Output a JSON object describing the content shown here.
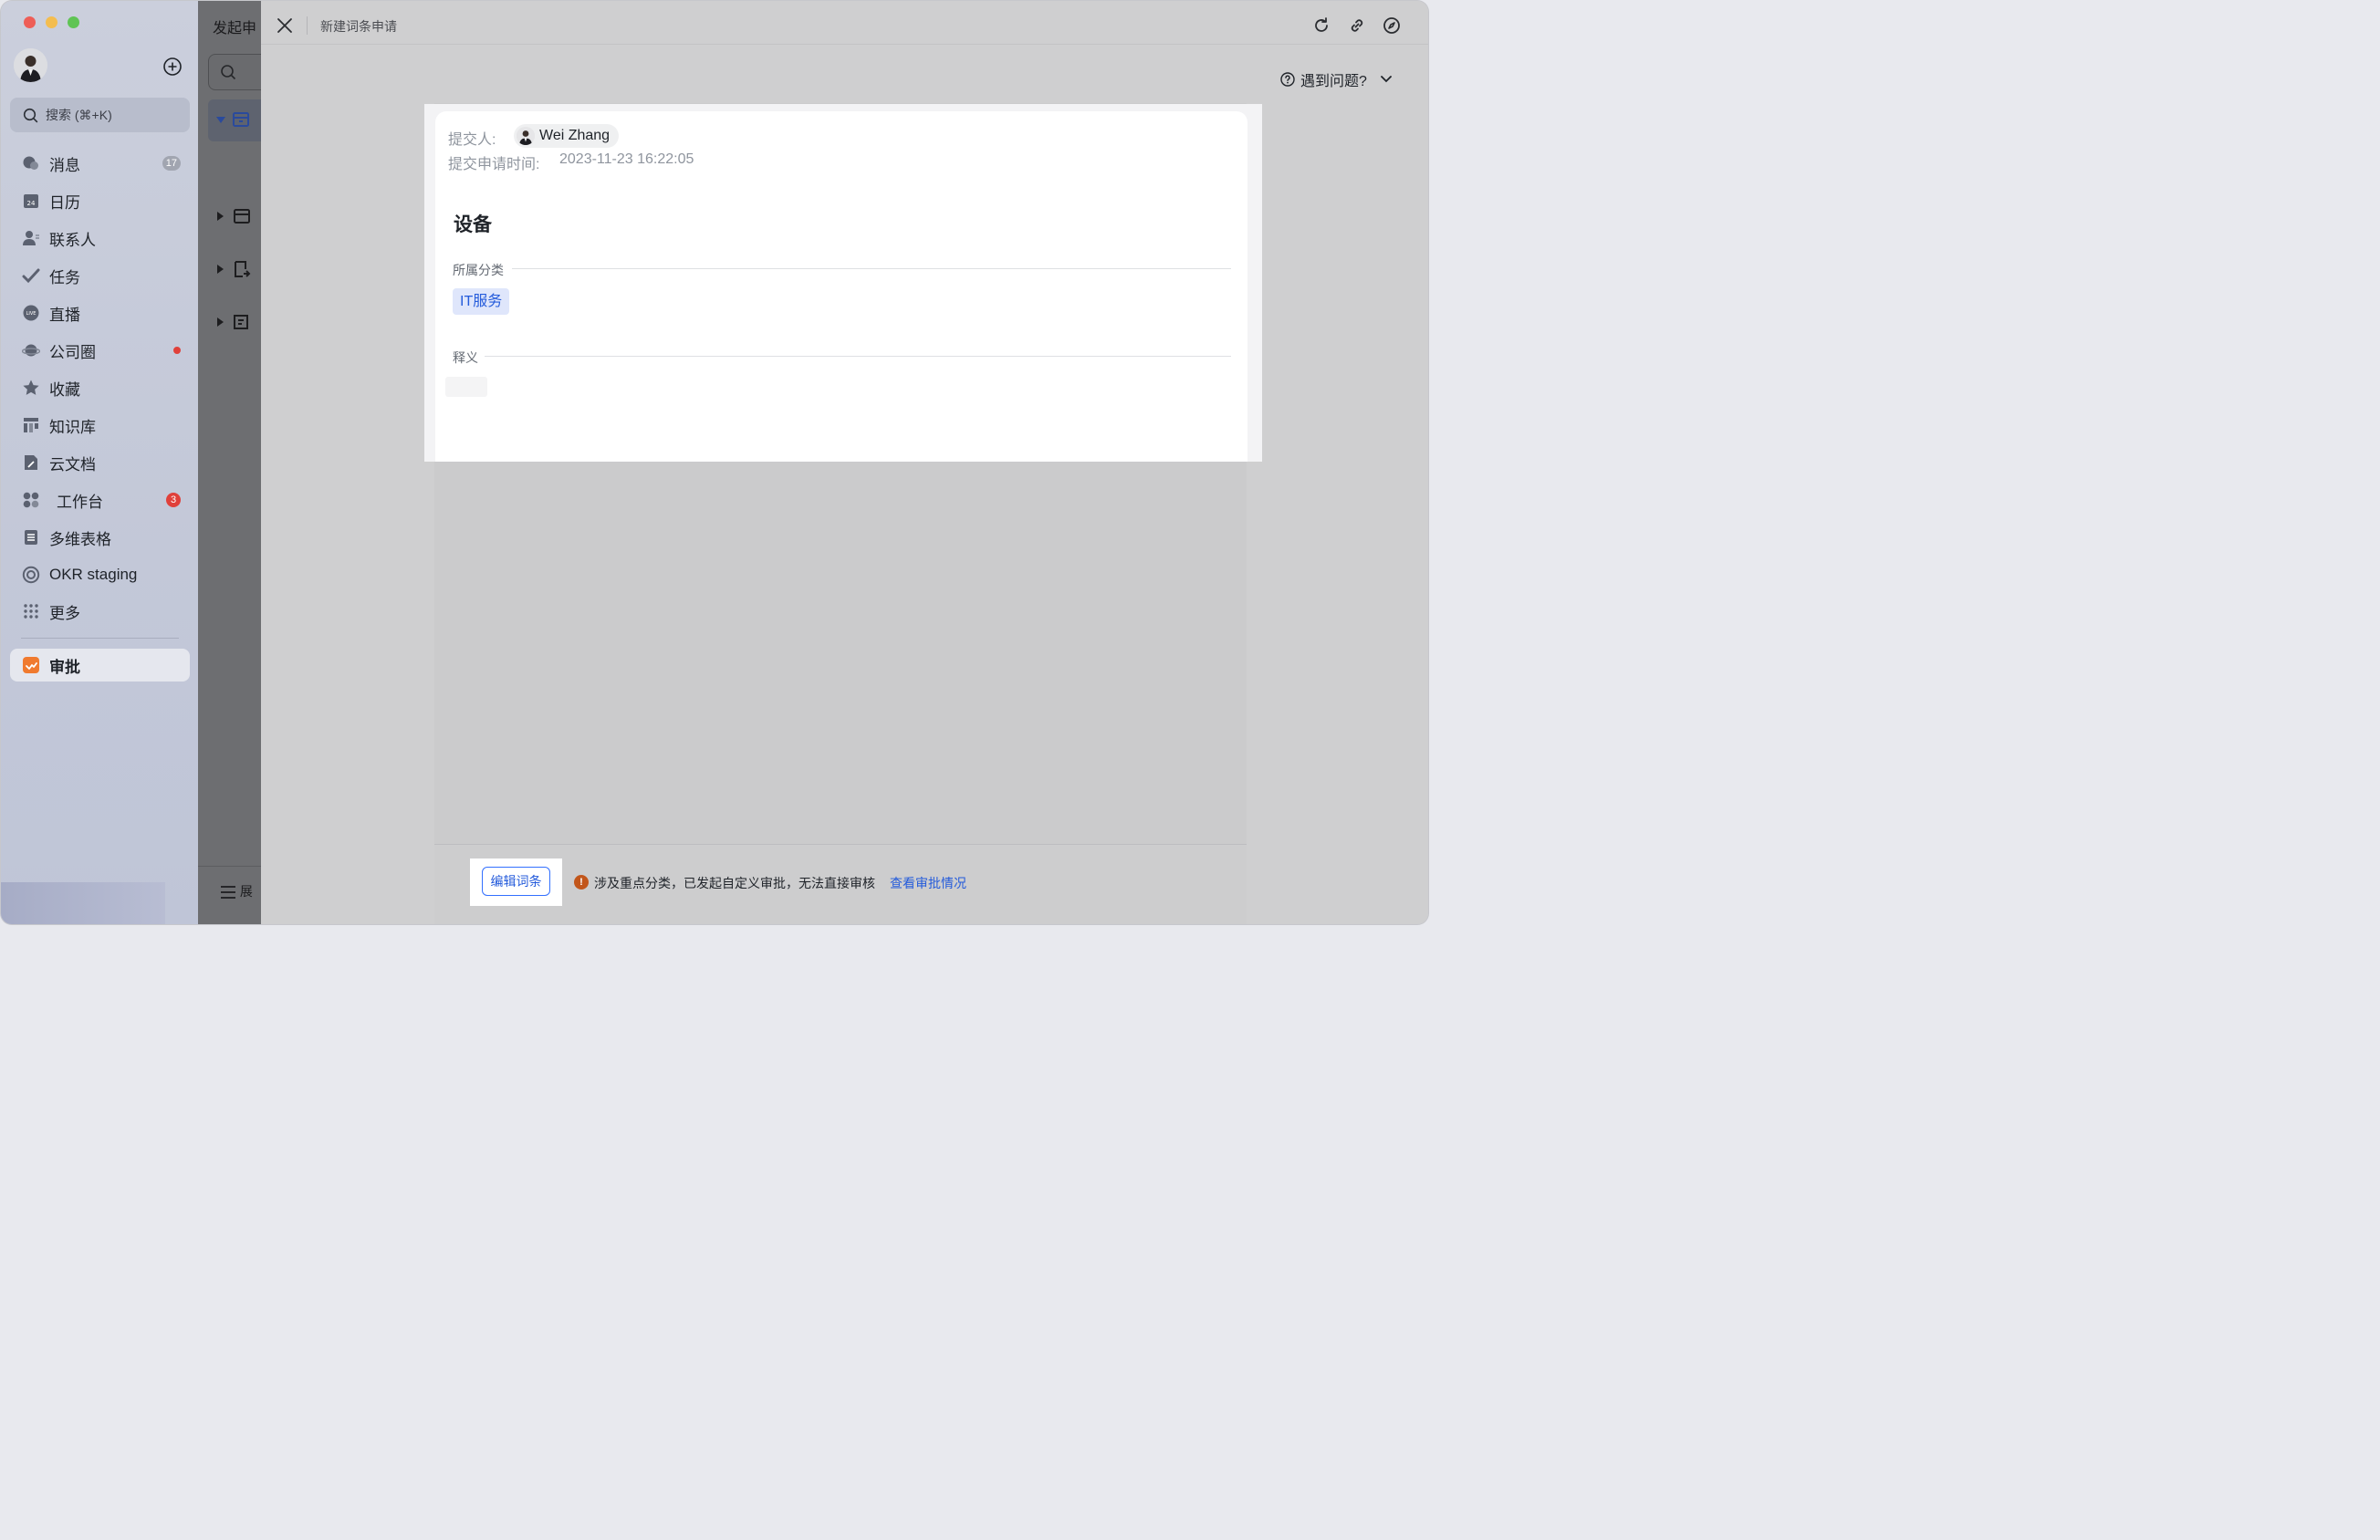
{
  "sidebar": {
    "search_placeholder": "搜索 (⌘+K)",
    "items": [
      {
        "label": "消息",
        "icon": "chat-bubble-icon",
        "badge": "17",
        "badge_color": "#a1a5b0"
      },
      {
        "label": "日历",
        "icon": "calendar-icon",
        "icon_text": "24"
      },
      {
        "label": "联系人",
        "icon": "contacts-icon"
      },
      {
        "label": "任务",
        "icon": "task-check-icon"
      },
      {
        "label": "直播",
        "icon": "live-icon",
        "icon_text": "LIVE"
      },
      {
        "label": "公司圈",
        "icon": "planet-icon",
        "has_dot": true,
        "dot_color": "#e0403a"
      },
      {
        "label": "收藏",
        "icon": "star-icon"
      },
      {
        "label": "知识库",
        "icon": "wiki-icon"
      },
      {
        "label": "云文档",
        "icon": "cloud-doc-icon"
      },
      {
        "label": "工作台",
        "icon": "workplace-grid-icon",
        "badge": "3",
        "badge_color": "#e0403a"
      },
      {
        "label": "多维表格",
        "icon": "base-table-icon"
      },
      {
        "label": "OKR staging",
        "icon": "okr-target-icon"
      },
      {
        "label": "更多",
        "icon": "more-dots-icon"
      }
    ],
    "active_item": {
      "label": "审批",
      "icon": "approval-app-icon",
      "icon_color": "#f07a2f"
    }
  },
  "middle": {
    "title": "发起申",
    "footer_label": "展"
  },
  "panel": {
    "title": "新建词条申请",
    "help_label": "遇到问题?",
    "card": {
      "submitter_label": "提交人:",
      "submitter_name": "Wei Zhang",
      "time_label": "提交申请时间:",
      "time_value": "2023-11-23 16:22:05",
      "term_title": "设备",
      "category_label": "所属分类",
      "category_value": "IT服务",
      "definition_label": "释义"
    },
    "footer": {
      "edit_button": "编辑词条",
      "warning_text": "涉及重点分类，已发起自定义审批，无法直接审核",
      "warning_link": "查看审批情况"
    }
  },
  "colors": {
    "accent": "#245bdb",
    "tag_bg": "#dfe6fb",
    "warning": "#c2561b",
    "approval_orange": "#f07a2f"
  }
}
